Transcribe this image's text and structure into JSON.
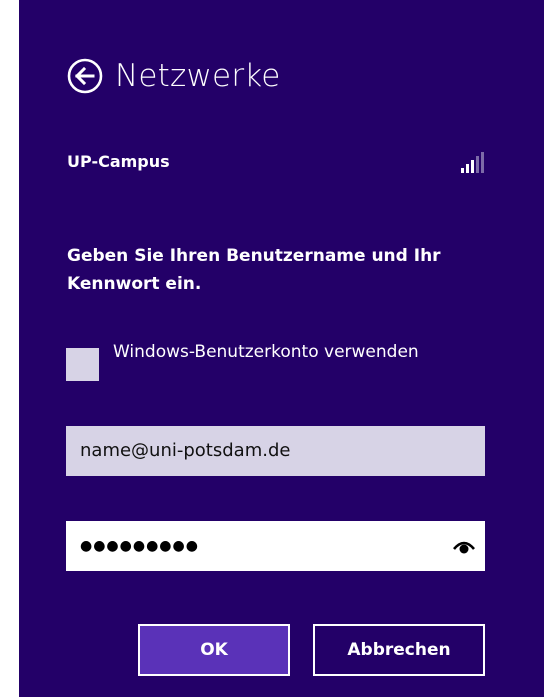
{
  "header": {
    "title": "Netzwerke",
    "back_icon": "back-arrow-circle-icon"
  },
  "network": {
    "name": "UP-Campus",
    "signal_icon": "signal-strength-icon",
    "signal_level": 0.6
  },
  "form": {
    "prompt": "Geben Sie Ihren Benutzername und Ihr Kennwort ein.",
    "checkbox_label": "Windows-Benutzerkonto verwenden",
    "checkbox_checked": false,
    "username_value": "name@uni-potsdam.de",
    "password_masked": "●●●●●●●●●",
    "reveal_icon": "eye-icon"
  },
  "buttons": {
    "ok_label": "OK",
    "cancel_label": "Abbrechen"
  },
  "colors": {
    "background": "#230068",
    "accent": "#5a32b8",
    "field": "#d7d3e6"
  }
}
